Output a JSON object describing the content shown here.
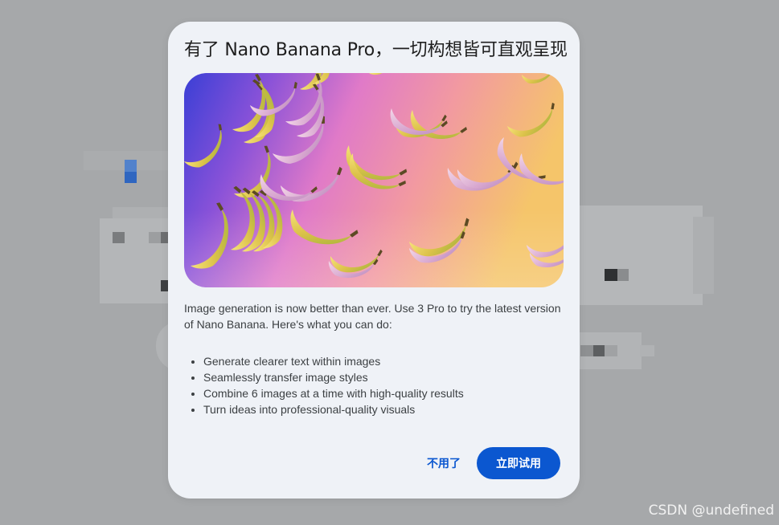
{
  "dialog": {
    "title": "有了 Nano Banana Pro，一切构想皆可直观呈现",
    "hero_image": {
      "subject": "floating bananas"
    },
    "description": "Image generation is now better than ever. Use 3 Pro to try the latest version of Nano Banana. Here's what you can do:",
    "features": [
      "Generate clearer text within images",
      "Seamlessly transfer image styles",
      "Combine 6 images at a time with high-quality results",
      "Turn ideas into professional-quality visuals"
    ],
    "buttons": {
      "dismiss_label": "不用了",
      "try_label": "立即试用"
    }
  },
  "watermark": "CSDN @undefined",
  "colors": {
    "accent": "#0b57d0",
    "dialog_background": "#eff2f7",
    "scrim": "#a6a8aa"
  }
}
